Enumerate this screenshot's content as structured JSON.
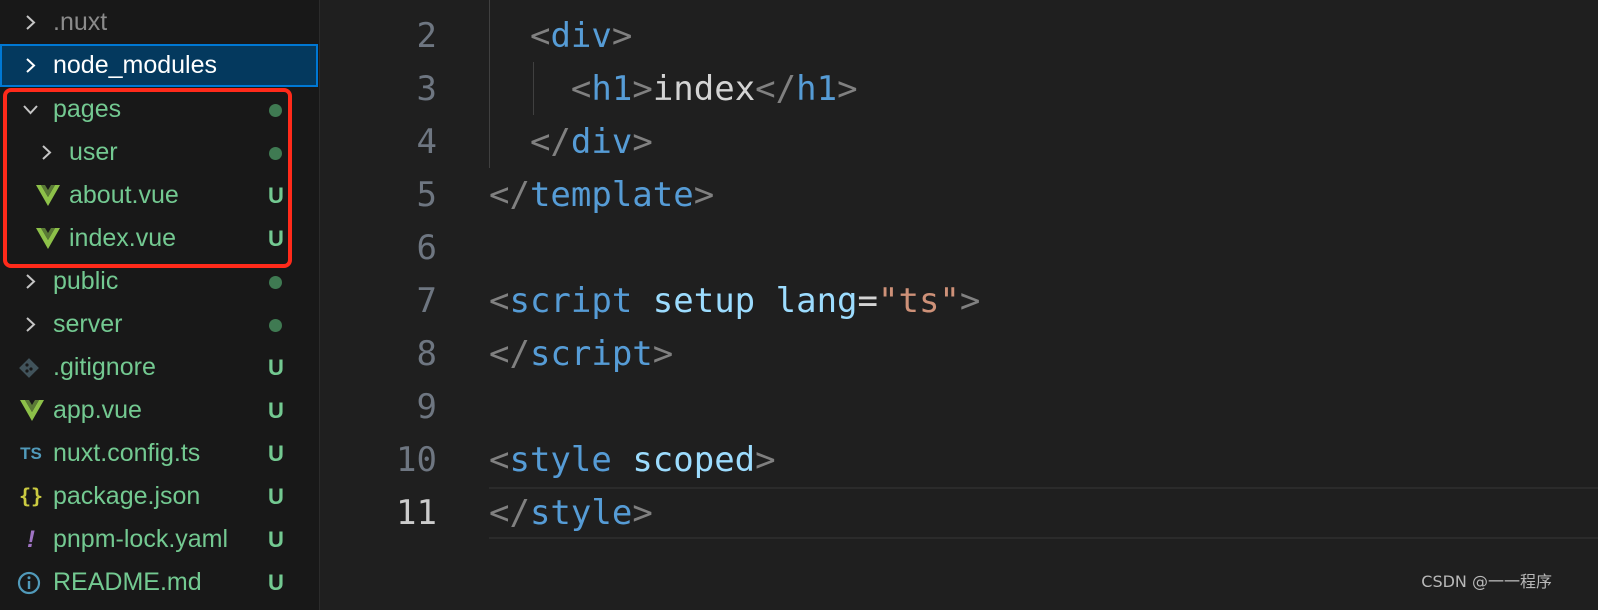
{
  "explorer": {
    "items": [
      {
        "label": ".nuxt",
        "type": "folder",
        "state": "collapsed"
      },
      {
        "label": "node_modules",
        "type": "folder",
        "state": "collapsed",
        "selected": true
      },
      {
        "label": "pages",
        "type": "folder",
        "state": "expanded",
        "git": "dot"
      },
      {
        "label": "user",
        "type": "folder",
        "state": "collapsed",
        "git": "dot"
      },
      {
        "label": "about.vue",
        "type": "file",
        "icon": "vue-icon",
        "git": "U"
      },
      {
        "label": "index.vue",
        "type": "file",
        "icon": "vue-icon",
        "git": "U"
      },
      {
        "label": "public",
        "type": "folder",
        "state": "collapsed",
        "git": "dot"
      },
      {
        "label": "server",
        "type": "folder",
        "state": "collapsed",
        "git": "dot"
      },
      {
        "label": ".gitignore",
        "type": "file",
        "icon": "git-icon",
        "git": "U"
      },
      {
        "label": "app.vue",
        "type": "file",
        "icon": "vue-icon",
        "git": "U"
      },
      {
        "label": "nuxt.config.ts",
        "type": "file",
        "icon": "typescript-icon",
        "icon_text": "TS",
        "git": "U"
      },
      {
        "label": "package.json",
        "type": "file",
        "icon": "json-icon",
        "icon_text": "{}",
        "git": "U"
      },
      {
        "label": "pnpm-lock.yaml",
        "type": "file",
        "icon": "yaml-icon",
        "icon_text": "!",
        "git": "U"
      },
      {
        "label": "README.md",
        "type": "file",
        "icon": "info-icon",
        "git": "U"
      }
    ]
  },
  "editor": {
    "lines": [
      {
        "num": "2",
        "tokens": [
          {
            "t": "  ",
            "c": "text"
          },
          {
            "t": "<",
            "c": "punc"
          },
          {
            "t": "div",
            "c": "tag"
          },
          {
            "t": ">",
            "c": "punc"
          }
        ]
      },
      {
        "num": "3",
        "tokens": [
          {
            "t": "    ",
            "c": "text"
          },
          {
            "t": "<",
            "c": "punc"
          },
          {
            "t": "h1",
            "c": "tag"
          },
          {
            "t": ">",
            "c": "punc"
          },
          {
            "t": "index",
            "c": "text"
          },
          {
            "t": "</",
            "c": "punc"
          },
          {
            "t": "h1",
            "c": "tag"
          },
          {
            "t": ">",
            "c": "punc"
          }
        ]
      },
      {
        "num": "4",
        "tokens": [
          {
            "t": "  ",
            "c": "text"
          },
          {
            "t": "</",
            "c": "punc"
          },
          {
            "t": "div",
            "c": "tag"
          },
          {
            "t": ">",
            "c": "punc"
          }
        ]
      },
      {
        "num": "5",
        "tokens": [
          {
            "t": "</",
            "c": "punc"
          },
          {
            "t": "template",
            "c": "tag"
          },
          {
            "t": ">",
            "c": "punc"
          }
        ]
      },
      {
        "num": "6",
        "tokens": []
      },
      {
        "num": "7",
        "tokens": [
          {
            "t": "<",
            "c": "punc"
          },
          {
            "t": "script",
            "c": "tag"
          },
          {
            "t": " ",
            "c": "text"
          },
          {
            "t": "setup",
            "c": "attr"
          },
          {
            "t": " ",
            "c": "text"
          },
          {
            "t": "lang",
            "c": "attr"
          },
          {
            "t": "=",
            "c": "text"
          },
          {
            "t": "\"ts\"",
            "c": "str"
          },
          {
            "t": ">",
            "c": "punc"
          }
        ]
      },
      {
        "num": "8",
        "tokens": [
          {
            "t": "</",
            "c": "punc"
          },
          {
            "t": "script",
            "c": "tag"
          },
          {
            "t": ">",
            "c": "punc"
          }
        ]
      },
      {
        "num": "9",
        "tokens": []
      },
      {
        "num": "10",
        "tokens": [
          {
            "t": "<",
            "c": "punc"
          },
          {
            "t": "style",
            "c": "tag"
          },
          {
            "t": " ",
            "c": "text"
          },
          {
            "t": "scoped",
            "c": "attr"
          },
          {
            "t": ">",
            "c": "punc"
          }
        ]
      },
      {
        "num": "11",
        "active": true,
        "tokens": [
          {
            "t": "</",
            "c": "punc"
          },
          {
            "t": "style",
            "c": "tag"
          },
          {
            "t": ">",
            "c": "punc"
          }
        ]
      }
    ]
  },
  "watermark": "CSDN @一一程序",
  "colors": {
    "folder_label": "#73c991",
    "git_untracked": "#73c991",
    "selection_bg": "#04395e",
    "highlight_box": "#ff2a1a",
    "tag": "#569cd6",
    "attr": "#9cdcfe",
    "string": "#ce9178"
  }
}
